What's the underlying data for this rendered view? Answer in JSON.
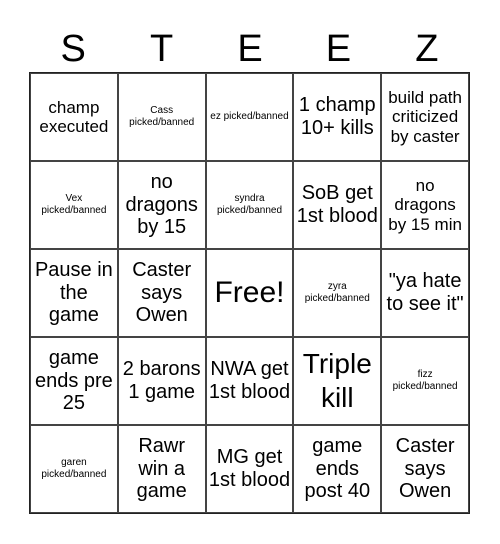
{
  "title_letters": [
    "S",
    "T",
    "E",
    "E",
    "Z"
  ],
  "cells": [
    [
      "champ executed",
      "Cass picked/banned",
      "ez picked/banned",
      "1 champ 10+ kills",
      "build path criticized by caster"
    ],
    [
      "Vex picked/banned",
      "no dragons by 15",
      "syndra picked/banned",
      "SoB get 1st blood",
      "no dragons by 15 min"
    ],
    [
      "Pause in the game",
      "Caster says Owen",
      "Free!",
      "zyra picked/banned",
      "\"ya hate to see it\""
    ],
    [
      "game ends pre 25",
      "2 barons 1 game",
      "NWA get 1st blood",
      "Triple kill",
      "fizz picked/banned"
    ],
    [
      "garen picked/banned",
      "Rawr win a game",
      "MG get 1st blood",
      "game ends post 40",
      "Caster says Owen"
    ]
  ]
}
